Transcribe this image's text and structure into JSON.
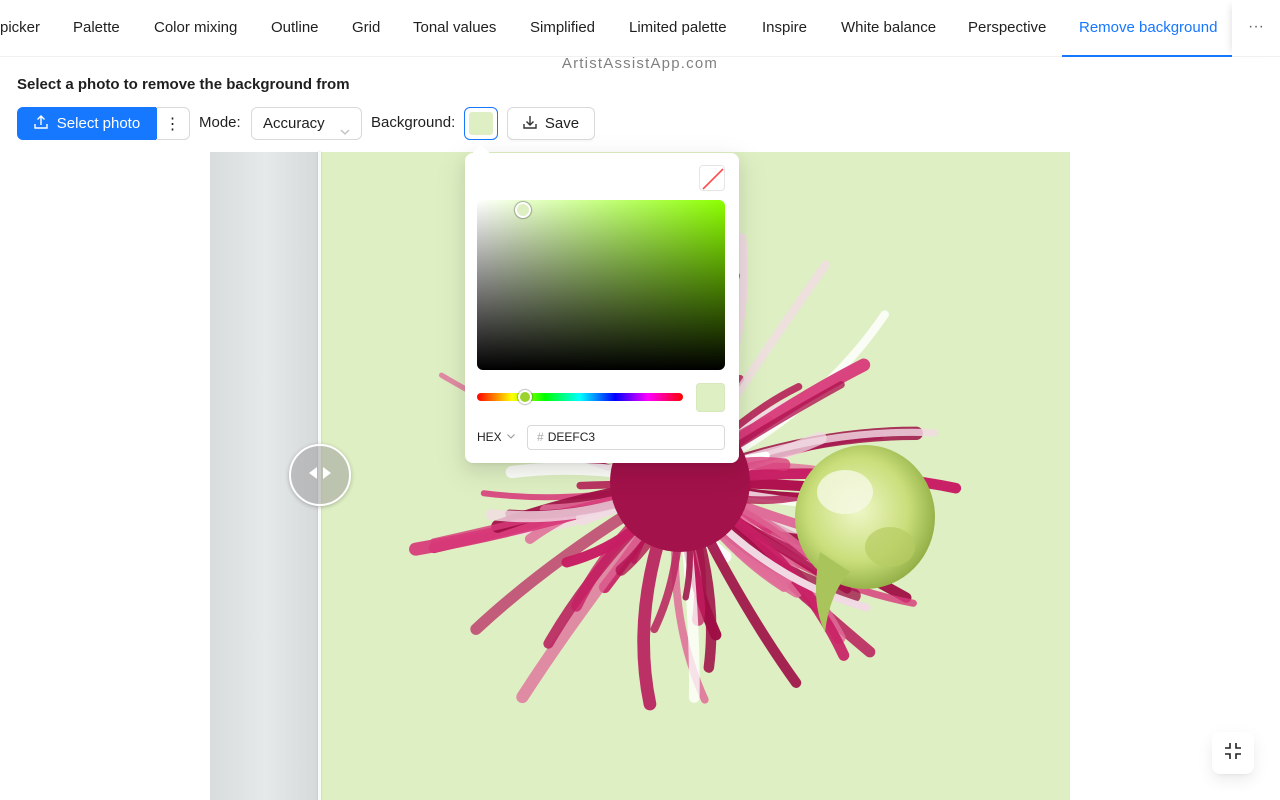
{
  "tabs": [
    {
      "label": "picker",
      "active": false
    },
    {
      "label": "Palette",
      "active": false
    },
    {
      "label": "Color mixing",
      "active": false
    },
    {
      "label": "Outline",
      "active": false
    },
    {
      "label": "Grid",
      "active": false
    },
    {
      "label": "Tonal values",
      "active": false
    },
    {
      "label": "Simplified",
      "active": false
    },
    {
      "label": "Limited palette",
      "active": false
    },
    {
      "label": "Inspire",
      "active": false
    },
    {
      "label": "White balance",
      "active": false
    },
    {
      "label": "Perspective",
      "active": false
    },
    {
      "label": "Remove background",
      "active": true
    }
  ],
  "more_label": "···",
  "watermark": "ArtistAssistApp.com",
  "heading": "Select a photo to remove the background from",
  "toolbar": {
    "select_photo_label": "Select photo",
    "more_options_label": "⋮",
    "mode_label": "Mode",
    "mode_value": "Accuracy",
    "background_label": "Background",
    "save_label": "Save"
  },
  "color_picker": {
    "format": "HEX",
    "hash": "#",
    "hex_value": "DEEFC3",
    "selected_color": "#deefc3",
    "hue_color": "#8cff00"
  },
  "colors": {
    "accent": "#1677ff",
    "background_swatch": "#deefc3"
  },
  "icons": {
    "upload": "upload-icon",
    "download": "download-icon",
    "chevron": "chevron-down-icon",
    "fullscreen_exit": "fullscreen-exit-icon",
    "compare_arrows": "compare-arrows-icon"
  }
}
